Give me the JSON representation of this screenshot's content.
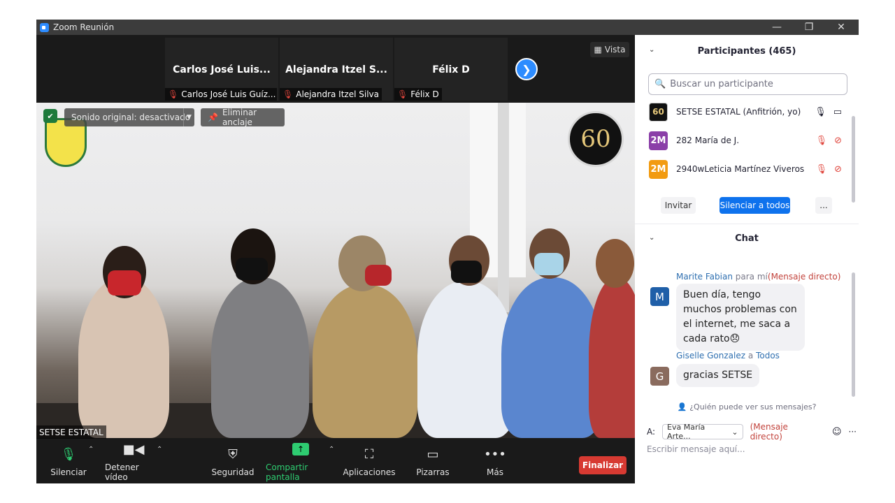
{
  "window": {
    "title": "Zoom Reunión",
    "controls": {
      "minimize": "—",
      "restore": "❐",
      "close": "✕"
    }
  },
  "gallery": {
    "tiles": [
      {
        "name": "Carlos José Luis...",
        "label": "Carlos José Luis Guíz..."
      },
      {
        "name": "Alejandra Itzel S...",
        "label": "Alejandra Itzel Silva"
      },
      {
        "name": "Félix D",
        "label": "Félix D"
      }
    ],
    "next_icon": "❯",
    "view_label": "Vista"
  },
  "video": {
    "sound_label": "Sonido original: desactivado",
    "unpin_label": "Eliminar anclaje",
    "logo_text": "60",
    "speaker_name": "SETSE ESTATAL"
  },
  "toolbar": {
    "mute": "Silenciar",
    "stop_video": "Detener vídeo",
    "security": "Seguridad",
    "share": "Compartir pantalla",
    "apps": "Aplicaciones",
    "whiteboards": "Pizarras",
    "more": "Más",
    "end": "Finalizar"
  },
  "participants": {
    "header": "Participantes (465)",
    "search_placeholder": "Buscar un participante",
    "list": [
      {
        "avatar": "60",
        "name": "SETSE ESTATAL (Anfitrión, yo)",
        "avatar_color": "#111111"
      },
      {
        "avatar": "2M",
        "name": "282 María de J.",
        "avatar_color": "#8b3fa8"
      },
      {
        "avatar": "2M",
        "name": "2940wLeticia Martínez Viveros",
        "avatar_color": "#f29b11"
      }
    ],
    "invite": "Invitar",
    "mute_all": "Silenciar a todos",
    "more": "..."
  },
  "chat": {
    "header": "Chat",
    "messages": [
      {
        "sender": "Marite Fabian",
        "to_prefix": "para mí",
        "tag": "(Mensaje directo)",
        "avatar": "M",
        "avatar_color": "#1f5fa8",
        "text": "Buen día, tengo muchos problemas con el internet, me saca a cada rato😞"
      },
      {
        "sender": "Giselle Gonzalez",
        "to_prefix": "a",
        "to": "Todos",
        "avatar": "G",
        "avatar_color": "#8a6b5e",
        "text": "gracias SETSE"
      }
    ],
    "who_can_see": "¿Quién puede ver sus mensajes?",
    "to_label": "A:",
    "recipient": "Eva María Arte...",
    "recipient_tag": "(Mensaje directo)",
    "compose_placeholder": "Escribir mensaje aquí..."
  }
}
